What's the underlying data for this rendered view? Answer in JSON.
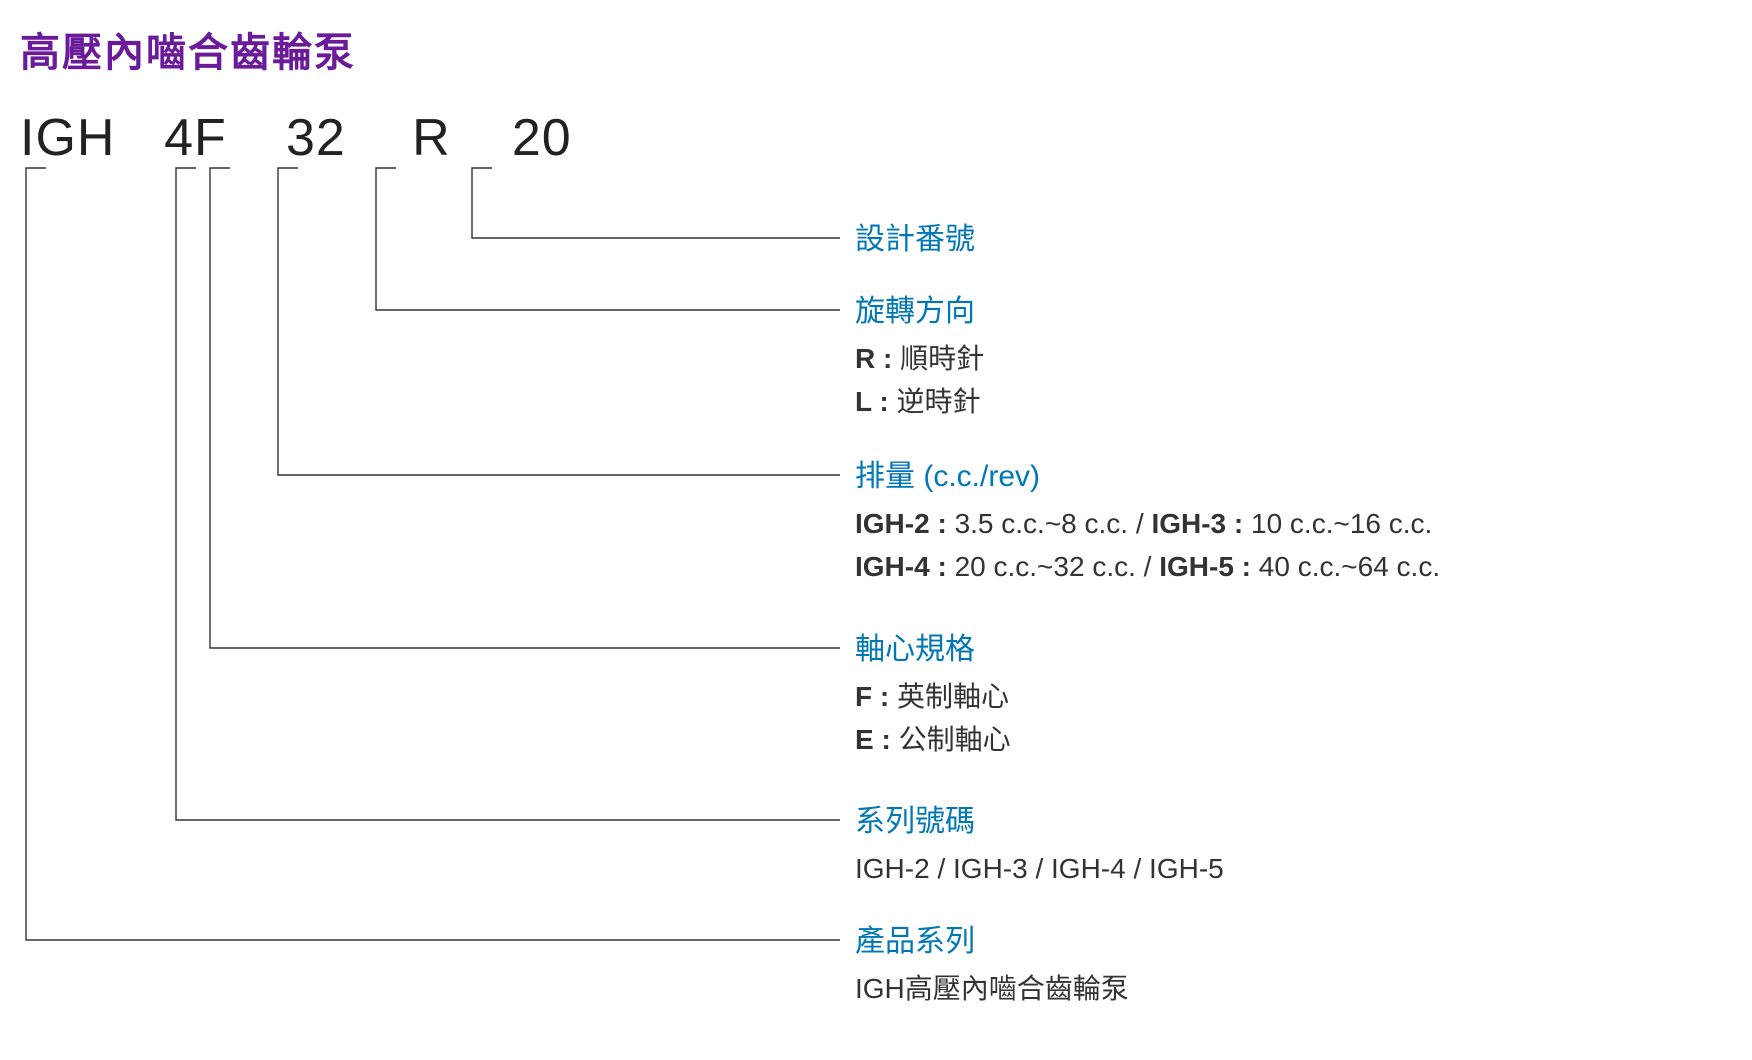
{
  "title": "高壓內嚙合齒輪泵",
  "code": {
    "seg1": "IGH",
    "seg2": "4F",
    "seg3": "32",
    "seg4": "R",
    "seg5": "20"
  },
  "sections": {
    "design_no": {
      "title": "設計番號"
    },
    "rotation": {
      "title": "旋轉方向",
      "r_key": "R : ",
      "r_val": "順時針",
      "l_key": "L : ",
      "l_val": "逆時針"
    },
    "displacement": {
      "title": "排量 (c.c./rev)",
      "row1_b1": "IGH-2 : ",
      "row1_t1": "3.5 c.c.~8 c.c. / ",
      "row1_b2": "IGH-3 : ",
      "row1_t2": "10 c.c.~16 c.c.",
      "row2_b1": "IGH-4 : ",
      "row2_t1": "20 c.c.~32 c.c. / ",
      "row2_b2": "IGH-5 : ",
      "row2_t2": "40 c.c.~64 c.c."
    },
    "shaft": {
      "title": "軸心規格",
      "f_key": "F : ",
      "f_val": "英制軸心",
      "e_key": "E : ",
      "e_val": "公制軸心"
    },
    "series_no": {
      "title": "系列號碼",
      "body": "IGH-2 / IGH-3 / IGH-4 / IGH-5"
    },
    "product": {
      "title": "產品系列",
      "body": "IGH高壓內嚙合齒輪泵"
    }
  }
}
